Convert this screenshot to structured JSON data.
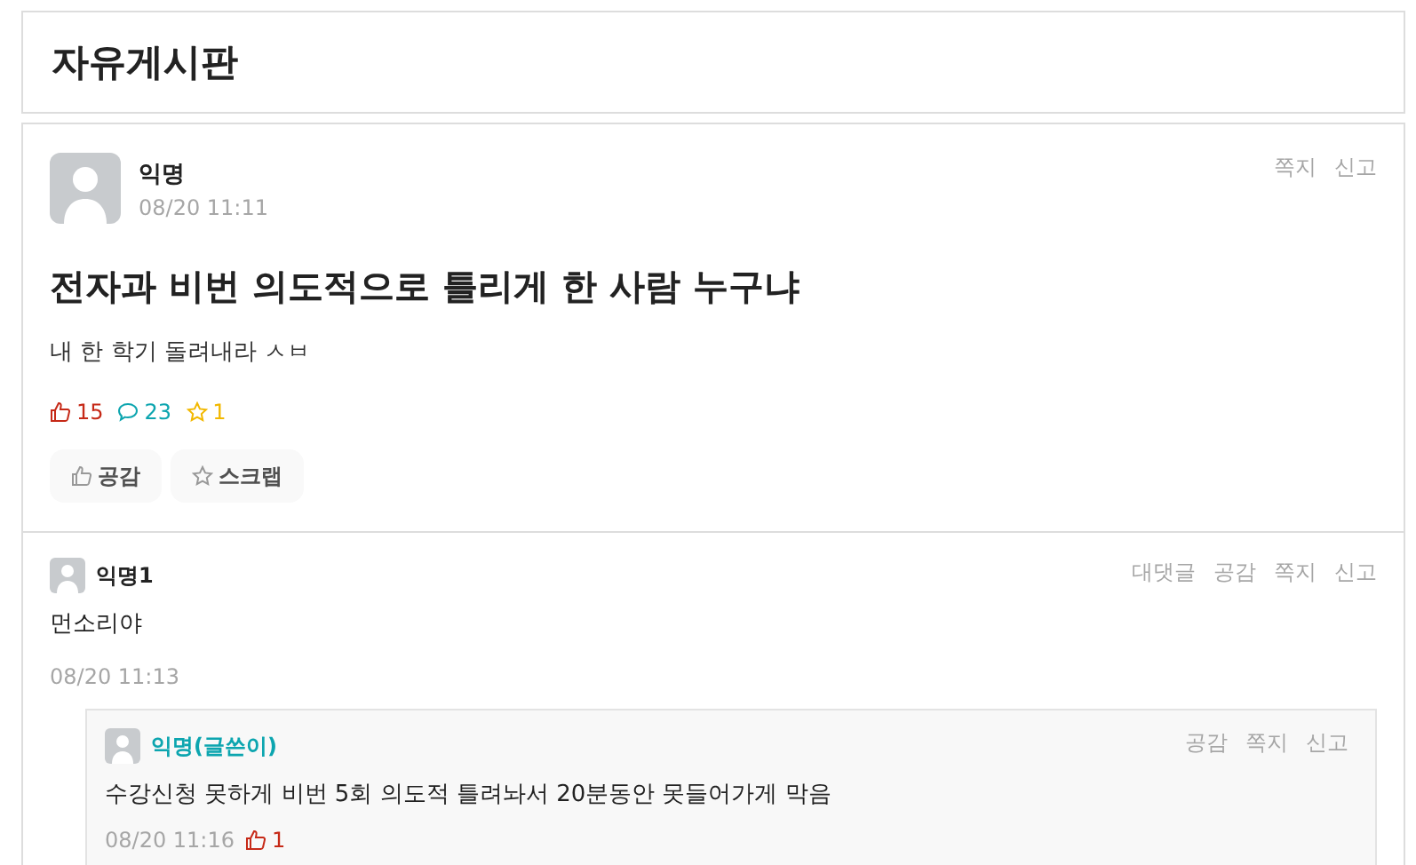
{
  "board": {
    "title": "자유게시판"
  },
  "post": {
    "author": "익명",
    "time": "08/20 11:11",
    "actions": [
      "쪽지",
      "신고"
    ],
    "title": "전자과 비번 의도적으로 틀리게 한 사람 누구냐",
    "body": "내 한 학기 돌려내라 ㅅㅂ",
    "stats": [
      {
        "kind": "likes",
        "value": "15"
      },
      {
        "kind": "comments",
        "value": "23"
      },
      {
        "kind": "scraps",
        "value": "1"
      }
    ],
    "buttons": [
      {
        "kind": "like",
        "label": "공감"
      },
      {
        "kind": "scrap",
        "label": "스크랩"
      }
    ]
  },
  "comments": [
    {
      "author": "익명1",
      "is_writer": false,
      "actions": [
        "대댓글",
        "공감",
        "쪽지",
        "신고"
      ],
      "text": "먼소리야",
      "time": "08/20 11:13",
      "replies": [
        {
          "author": "익명(글쓴이)",
          "is_writer": true,
          "actions": [
            "공감",
            "쪽지",
            "신고"
          ],
          "text": "수강신청 못하게 비번 5회 의도적 틀려놔서 20분동안 못들어가게 막음",
          "time": "08/20 11:16",
          "likes": "1"
        }
      ]
    }
  ]
}
